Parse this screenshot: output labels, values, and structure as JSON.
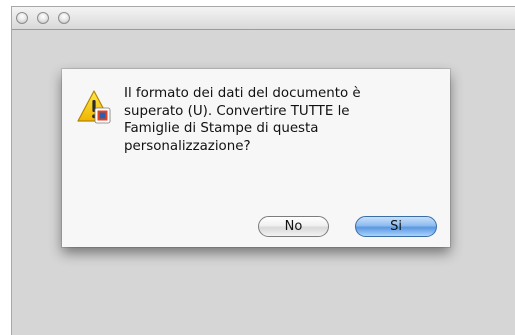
{
  "window": {
    "traffic_lights": [
      "close-button",
      "minimize-button",
      "zoom-button"
    ]
  },
  "dialog": {
    "icon": "warning-icon",
    "message": "Il formato dei dati del documento è\nsuperato (U). Convertire TUTTE le\nFamiglie di Stampe di questa\npersonalizzazione?",
    "buttons": {
      "no_label": "No",
      "yes_label": "Si"
    },
    "colors": {
      "default_button": "#5a98e0",
      "warning": "#f5c400"
    }
  }
}
